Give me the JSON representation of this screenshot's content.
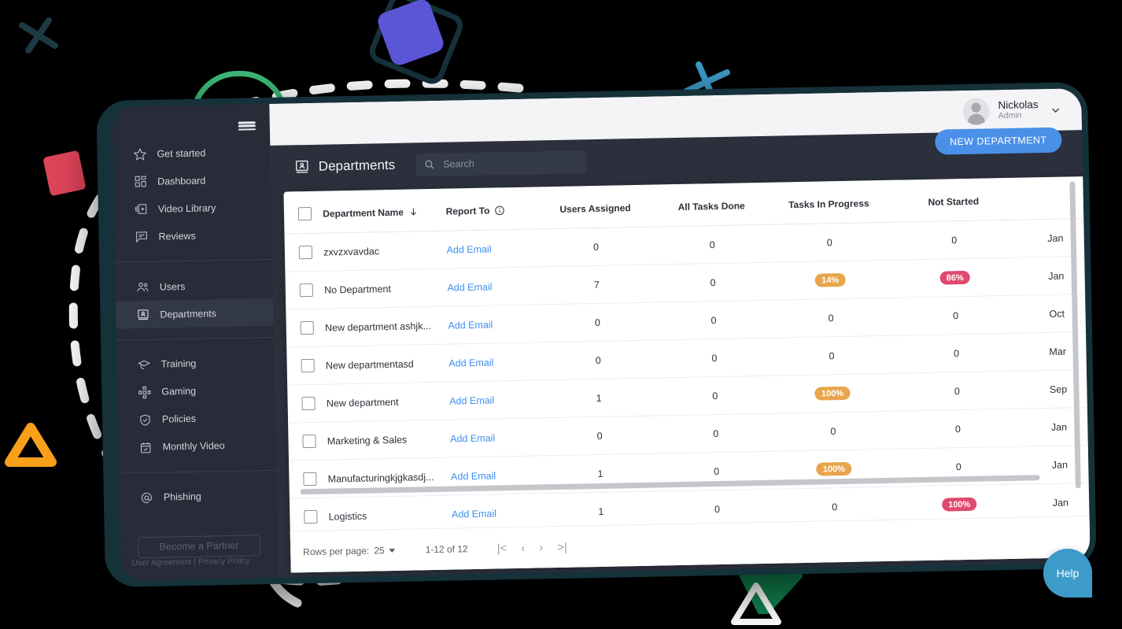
{
  "sidebar": {
    "menu_icon": "hamburger-icon",
    "groups": [
      {
        "items": [
          {
            "label": "Get started",
            "icon": "star-icon"
          },
          {
            "label": "Dashboard",
            "icon": "dashboard-grid-icon"
          },
          {
            "label": "Video Library",
            "icon": "video-library-icon"
          },
          {
            "label": "Reviews",
            "icon": "chat-review-icon"
          }
        ]
      },
      {
        "items": [
          {
            "label": "Users",
            "icon": "users-icon"
          },
          {
            "label": "Departments",
            "icon": "department-card-icon",
            "active": true
          }
        ]
      },
      {
        "items": [
          {
            "label": "Training",
            "icon": "graduation-cap-icon"
          },
          {
            "label": "Gaming",
            "icon": "gamepad-icon"
          },
          {
            "label": "Policies",
            "icon": "shield-check-icon"
          },
          {
            "label": "Monthly Video",
            "icon": "calendar-check-icon"
          }
        ]
      },
      {
        "items": [
          {
            "label": "Phishing",
            "icon": "at-sign-icon"
          }
        ]
      }
    ],
    "partner_button": "Become a Partner",
    "legal": {
      "user_agreement": "User Agreement",
      "divider": "|",
      "privacy_policy": "Privacy Policy"
    }
  },
  "topbar": {
    "user_name": "Nickolas",
    "user_role": "Admin",
    "avatar_icon": "user-avatar-icon",
    "chevron_icon": "chevron-down-icon"
  },
  "page": {
    "title": "Departments",
    "title_icon": "department-card-icon",
    "new_button": "NEW DEPARTMENT",
    "accent_color": "#4a90e8"
  },
  "search": {
    "placeholder": "Search",
    "value": "",
    "icon": "search-icon"
  },
  "table": {
    "columns": [
      {
        "label": "Department Name",
        "sort_icon": "arrow-down-icon"
      },
      {
        "label": "Report To",
        "info_icon": "info-circle-icon"
      },
      {
        "label": "Users Assigned"
      },
      {
        "label": "All Tasks Done"
      },
      {
        "label": "Tasks In Progress"
      },
      {
        "label": "Not Started"
      }
    ],
    "link_label": "Add Email",
    "rows": [
      {
        "name": "zxvzxvavdac",
        "report_to": "Add Email",
        "users": "0",
        "done": "0",
        "in_progress": "0",
        "in_progress_badge": false,
        "not_started": "0",
        "not_started_badge": false,
        "date": "Jan"
      },
      {
        "name": "No Department",
        "report_to": "Add Email",
        "users": "7",
        "done": "0",
        "in_progress": "14%",
        "in_progress_badge": true,
        "not_started": "86%",
        "not_started_badge": true,
        "date": "Jan"
      },
      {
        "name": "New department ashjk...",
        "report_to": "Add Email",
        "users": "0",
        "done": "0",
        "in_progress": "0",
        "in_progress_badge": false,
        "not_started": "0",
        "not_started_badge": false,
        "date": "Oct"
      },
      {
        "name": "New departmentasd",
        "report_to": "Add Email",
        "users": "0",
        "done": "0",
        "in_progress": "0",
        "in_progress_badge": false,
        "not_started": "0",
        "not_started_badge": false,
        "date": "Mar"
      },
      {
        "name": "New department",
        "report_to": "Add Email",
        "users": "1",
        "done": "0",
        "in_progress": "100%",
        "in_progress_badge": true,
        "not_started": "0",
        "not_started_badge": false,
        "date": "Sep"
      },
      {
        "name": "Marketing & Sales",
        "report_to": "Add Email",
        "users": "0",
        "done": "0",
        "in_progress": "0",
        "in_progress_badge": false,
        "not_started": "0",
        "not_started_badge": false,
        "date": "Jan"
      },
      {
        "name": "Manufacturingkjgkasdj...",
        "report_to": "Add Email",
        "users": "1",
        "done": "0",
        "in_progress": "100%",
        "in_progress_badge": true,
        "not_started": "0",
        "not_started_badge": false,
        "date": "Jan"
      },
      {
        "name": "Logistics",
        "report_to": "Add Email",
        "users": "1",
        "done": "0",
        "in_progress": "0",
        "in_progress_badge": false,
        "not_started": "100%",
        "not_started_badge": true,
        "date": "Jan"
      }
    ],
    "badge_colors": {
      "in_progress": "#e8a54b",
      "not_started": "#e0486e"
    }
  },
  "footer": {
    "rows_per_page_label": "Rows per page:",
    "rows_per_page_value": "25",
    "range": "1-12 of 12",
    "first_icon": "|<",
    "prev_icon": "‹",
    "next_icon": "›",
    "last_icon": ">|"
  },
  "help": {
    "label": "Help"
  }
}
